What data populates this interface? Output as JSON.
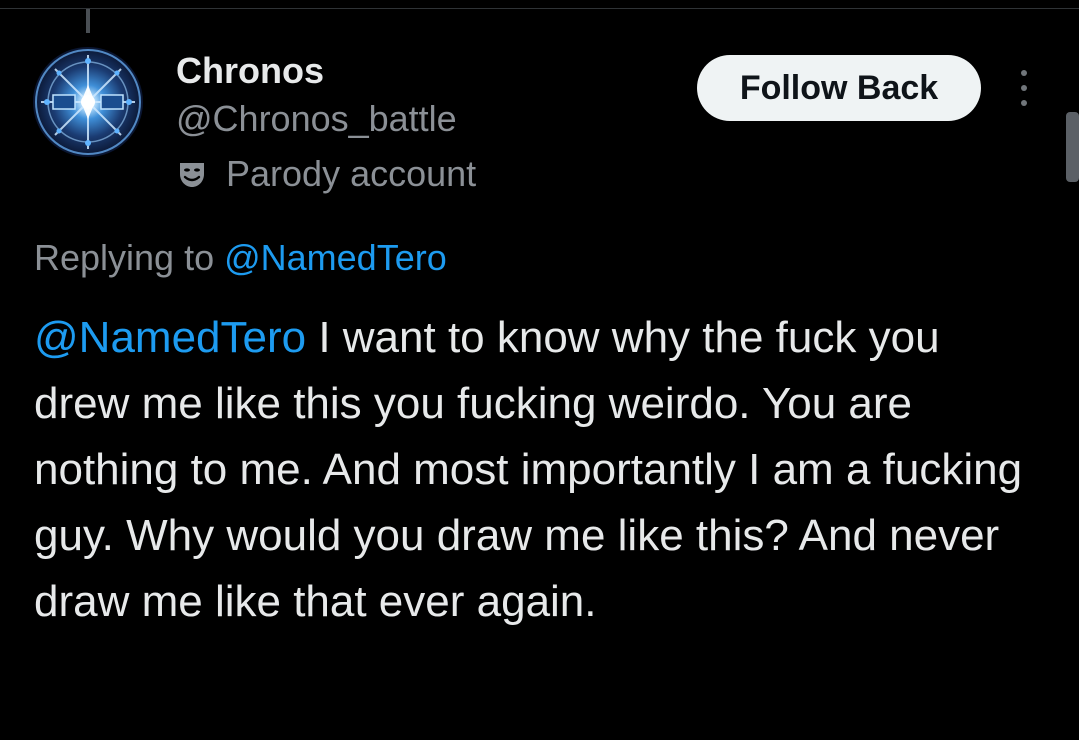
{
  "author": {
    "display_name": "Chronos",
    "handle": "@Chronos_battle",
    "label": "Parody account",
    "label_icon": "theater-masks-icon",
    "avatar_icon": "glowing-compass-emblem-avatar"
  },
  "actions": {
    "follow_label": "Follow Back",
    "more_icon": "vertical-ellipsis-icon"
  },
  "reply": {
    "prefix": "Replying to ",
    "mention": "@NamedTero"
  },
  "tweet": {
    "mention": "@NamedTero",
    "text": " I want to know why the fuck you drew me like this you fucking weirdo. You are nothing to me. And most importantly I am a fucking guy. Why would you draw me like this? And never draw me like that ever again."
  },
  "colors": {
    "background": "#000000",
    "text_primary": "#e7e9ea",
    "text_secondary": "#8b9096",
    "link": "#1d9bf0",
    "button_bg": "#eff3f4",
    "button_text": "#0f1419"
  }
}
